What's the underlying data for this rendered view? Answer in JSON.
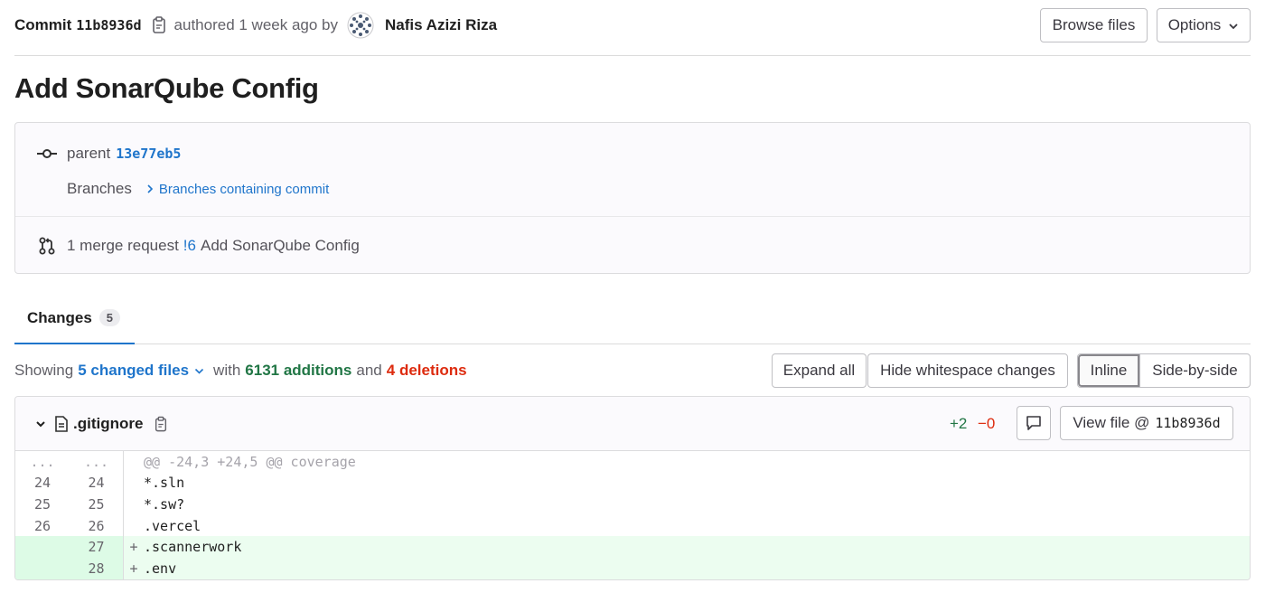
{
  "header": {
    "commit_label": "Commit",
    "commit_sha": "11b8936d",
    "authored_text": "authored 1 week ago by",
    "author_name": "Nafis Azizi Riza",
    "browse_files_label": "Browse files",
    "options_label": "Options"
  },
  "title": "Add SonarQube Config",
  "info": {
    "parent_label": "parent",
    "parent_sha": "13e77eb5",
    "branches_label": "Branches",
    "branches_link": "Branches containing commit",
    "merge_request_prefix": "1 merge request",
    "merge_request_ref": "!6",
    "merge_request_title": "Add SonarQube Config"
  },
  "tabs": [
    {
      "label": "Changes",
      "count": "5"
    }
  ],
  "summary": {
    "showing_label": "Showing",
    "changed_files": "5 changed files",
    "with_label": "with",
    "additions": "6131 additions",
    "and_label": "and",
    "deletions": "4 deletions",
    "expand_all_label": "Expand all",
    "hide_whitespace_label": "Hide whitespace changes",
    "inline_label": "Inline",
    "side_by_side_label": "Side-by-side"
  },
  "file": {
    "name": ".gitignore",
    "additions": "+2",
    "deletions": "−0",
    "view_file_label": "View file @",
    "view_file_sha": "11b8936d",
    "lines": [
      {
        "type": "hunk",
        "old": "...",
        "new": "...",
        "marker": "",
        "code": "@@ -24,3 +24,5 @@ coverage"
      },
      {
        "type": "context",
        "old": "24",
        "new": "24",
        "marker": "",
        "code": "*.sln"
      },
      {
        "type": "context",
        "old": "25",
        "new": "25",
        "marker": "",
        "code": "*.sw?"
      },
      {
        "type": "context",
        "old": "26",
        "new": "26",
        "marker": "",
        "code": ".vercel"
      },
      {
        "type": "added",
        "old": "",
        "new": "27",
        "marker": "+",
        "code": ".scannerwork"
      },
      {
        "type": "added",
        "old": "",
        "new": "28",
        "marker": "+",
        "code": ".env"
      }
    ]
  }
}
